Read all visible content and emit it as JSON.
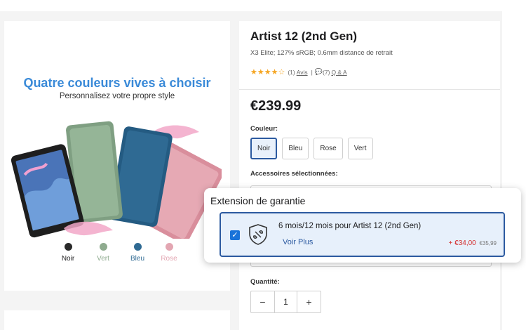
{
  "image_panel": {
    "headline": "Quatre couleurs vives à choisir",
    "subline": "Personnalisez votre propre style",
    "swatches": [
      {
        "label": "Noir",
        "color": "#2a2a2a"
      },
      {
        "label": "Vert",
        "color": "#8fab8f"
      },
      {
        "label": "Bleu",
        "color": "#2f6a93"
      },
      {
        "label": "Rose",
        "color": "#e3a6b2"
      }
    ]
  },
  "product": {
    "title": "Artist 12 (2nd Gen)",
    "specs": "X3 Elite; 127% sRGB; 0.6mm distance de retrait",
    "rating": {
      "stars": "★★★★☆",
      "count": "(1)",
      "avis": "Avis",
      "separator": "|",
      "qa_count": "(7)",
      "qa": "Q & A",
      "value": 4,
      "max": 5
    },
    "price": "€239.99",
    "color_label": "Couleur:",
    "color_options": [
      "Noir",
      "Bleu",
      "Rose",
      "Vert"
    ],
    "selected_color": "Noir",
    "accessories_label": "Accessoires sélectionnées:",
    "quantity_label": "Quantité:",
    "quantity": "1",
    "minus": "−",
    "plus": "+"
  },
  "popup": {
    "title": "Extension de garantie",
    "item": {
      "checked": true,
      "check_glyph": "✓",
      "name": "6 mois/12 mois pour Artist 12 (2nd Gen)",
      "more": "Voir Plus",
      "price": "+ €34,00",
      "old_price": "€35,99"
    }
  },
  "colors": {
    "accent": "#2c5aa0",
    "headline": "#3a8ad8",
    "sale": "#d42a2a",
    "star": "#f5a623"
  }
}
